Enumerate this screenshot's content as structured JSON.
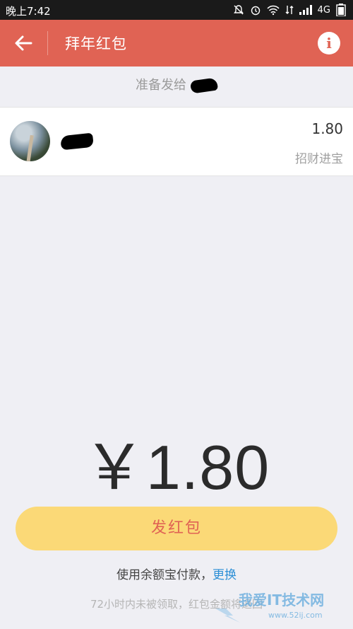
{
  "status_bar": {
    "time": "晚上7:42",
    "network": "4G",
    "icons": [
      "bell-muted-icon",
      "alarm-icon",
      "wifi-icon",
      "data-icon",
      "signal-icon"
    ]
  },
  "header": {
    "title": "拜年红包",
    "background": "#e06354"
  },
  "send_to": {
    "label": "准备发给"
  },
  "recipient": {
    "amount": "1.80",
    "greeting": "招财进宝"
  },
  "total": {
    "display": "￥1.80"
  },
  "send_button": {
    "label": "发红包",
    "background": "#fbd977"
  },
  "payment": {
    "text": "使用余额宝付款，",
    "change_link": "更换"
  },
  "notice": {
    "text": "72小时内未被领取，红包金额将退回"
  },
  "watermark": {
    "brand": "我爱IT技术网",
    "url": "www.52ij.com"
  }
}
